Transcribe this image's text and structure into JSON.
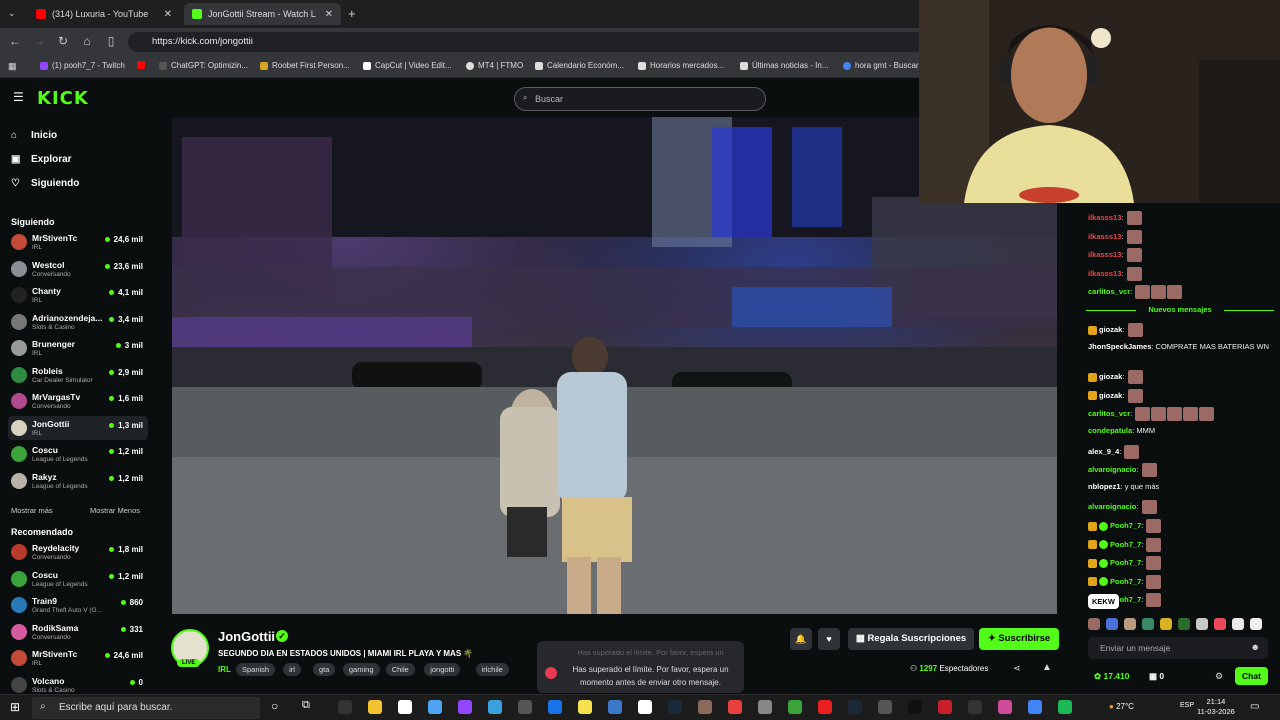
{
  "browser": {
    "tabs": [
      {
        "title": "(314) Luxuria - YouTube",
        "color": "#ff0000"
      },
      {
        "title": "JonGottii Stream - Watch L",
        "color": "#53fc18"
      }
    ],
    "url": "https://kick.com/jongottii",
    "bookmarks": [
      {
        "label": "(1) pooh7_7 - Twitch",
        "color": "#9146ff"
      },
      {
        "label": "",
        "color": "#ff0000"
      },
      {
        "label": "ChatGPT: Optimizin...",
        "color": "#444"
      },
      {
        "label": "Roobet First Person...",
        "color": "#d6a520"
      },
      {
        "label": "CapCut | Video Edit...",
        "color": "#ffffff"
      },
      {
        "label": "MT4 | FTMO",
        "color": "#dddddd"
      },
      {
        "label": "Calendario Económ...",
        "color": "#dddddd"
      },
      {
        "label": "Horarios mercados...",
        "color": "#dddddd"
      },
      {
        "label": "Últimas noticias - In...",
        "color": "#dddddd"
      },
      {
        "label": "hora gmt - Buscar",
        "color": "#4285f4"
      }
    ]
  },
  "kick": {
    "search_placeholder": "Buscar",
    "nav": [
      "Inicio",
      "Explorar",
      "Siguiendo"
    ],
    "following_header": "Siguiendo",
    "following": [
      {
        "name": "MrStivenTc",
        "category": "IRL",
        "viewers": "24,6 mil",
        "color": "#c24b3a"
      },
      {
        "name": "Westcol",
        "category": "Conversando",
        "viewers": "23,6 mil",
        "color": "#8a8f96"
      },
      {
        "name": "Chanty",
        "category": "IRL",
        "viewers": "4,1 mil",
        "color": "#222"
      },
      {
        "name": "Adrianozendeja...",
        "category": "Slots & Casino",
        "viewers": "3,4 mil",
        "color": "#777"
      },
      {
        "name": "Brunenger",
        "category": "IRL",
        "viewers": "3 mil",
        "color": "#9a9a9a"
      },
      {
        "name": "Robleis",
        "category": "Car Dealer Simulator",
        "viewers": "2,9 mil",
        "color": "#2d8a3e"
      },
      {
        "name": "MrVargasTv",
        "category": "Conversando",
        "viewers": "1,6 mil",
        "color": "#b04a8e"
      },
      {
        "name": "JonGottii",
        "category": "IRL",
        "viewers": "1,3 mil",
        "color": "#d9d2c0"
      },
      {
        "name": "Coscu",
        "category": "League of Legends",
        "viewers": "1,2 mil",
        "color": "#3aa33a"
      },
      {
        "name": "Rakyz",
        "category": "League of Legends",
        "viewers": "1,2 mil",
        "color": "#b8b2a8"
      }
    ],
    "show_more": "Mostrar más",
    "show_less": "Mostrar Menos",
    "recommended_header": "Recomendado",
    "recommended": [
      {
        "name": "Reydelacity",
        "category": "Conversando",
        "viewers": "1,8 mil",
        "color": "#b73a2a"
      },
      {
        "name": "Coscu",
        "category": "League of Legends",
        "viewers": "1,2 mil",
        "color": "#3aa33a"
      },
      {
        "name": "Train9",
        "category": "Grand Theft Auto V (G...",
        "viewers": "860",
        "color": "#2a7ab8"
      },
      {
        "name": "RodikSama",
        "category": "Conversando",
        "viewers": "331",
        "color": "#d65aa0"
      },
      {
        "name": "MrStivenTc",
        "category": "IRL",
        "viewers": "24,6 mil",
        "color": "#c24b3a"
      },
      {
        "name": "Volcano",
        "category": "Slots & Casino",
        "viewers": "0",
        "color": "#444"
      }
    ]
  },
  "stream": {
    "streamer": "JonGottii",
    "live": "LIVE",
    "title": "SEGUNDO DIA EN ESTADOS UNIDOS | MIAMI IRL PLAYA Y MAS 🌴",
    "category": "IRL",
    "tags": [
      "Spanish",
      "irl",
      "gta",
      "gaming",
      "Chile",
      "jongotti",
      "irlchile"
    ],
    "gift_label": "Regala Suscripciones",
    "subscribe_label": "Suscribirse",
    "viewers_count": "1297",
    "viewers_label": "Espectadores",
    "toast_faded": "Has superado el límite. Por favor, espera un",
    "toast_text": "Has superado el límite. Por favor, espera un momento antes de enviar otro mensaje."
  },
  "chat": {
    "messages_before": [
      {
        "user": "ilkasss13",
        "text": "",
        "color": "#e84848",
        "emotes": 1
      },
      {
        "user": "ilkasss13",
        "text": "",
        "color": "#e84848",
        "emotes": 1
      },
      {
        "user": "ilkasss13",
        "text": "",
        "color": "#e84848",
        "emotes": 1
      },
      {
        "user": "ilkasss13",
        "text": "",
        "color": "#e84848",
        "emotes": 1
      },
      {
        "user": "carlitos_vcr",
        "text": "",
        "color": "#53fc18",
        "emotes": 3
      }
    ],
    "new_messages": "Nuevos mensajes",
    "messages_after": [
      {
        "user": "giozak",
        "text": "",
        "color": "#fff",
        "emotes": 1,
        "badge": true
      },
      {
        "user": "JhonSpeckJames",
        "text": "COMPRATE MAS BATERIAS WN",
        "color": "#fff",
        "emotes": 0
      },
      {
        "user": "giozak",
        "text": "",
        "color": "#fff",
        "emotes": 1,
        "badge": true
      },
      {
        "user": "giozak",
        "text": "",
        "color": "#fff",
        "emotes": 1,
        "badge": true
      },
      {
        "user": "carlitos_vcr",
        "text": "",
        "color": "#53fc18",
        "emotes": 5
      },
      {
        "user": "condepatula",
        "text": "MMM",
        "color": "#53fc18",
        "emotes": 0
      },
      {
        "user": "alex_9_4",
        "text": "",
        "color": "#fff",
        "emotes": 1
      },
      {
        "user": "alvaroignacio",
        "text": "",
        "color": "#53fc18",
        "emotes": 1
      },
      {
        "user": "nblopez1",
        "text": "y que más",
        "color": "#fff",
        "emotes": 0
      },
      {
        "user": "alvaroignacio",
        "text": "",
        "color": "#53fc18",
        "emotes": 1
      },
      {
        "user": "Pooh7_7",
        "text": "",
        "color": "#53fc18",
        "emotes": 1,
        "badge": true
      },
      {
        "user": "Pooh7_7",
        "text": "",
        "color": "#53fc18",
        "emotes": 1,
        "badge": true
      },
      {
        "user": "Pooh7_7",
        "text": "",
        "color": "#53fc18",
        "emotes": 1,
        "badge": true
      },
      {
        "user": "Pooh7_7",
        "text": "",
        "color": "#53fc18",
        "emotes": 1,
        "badge": true
      },
      {
        "user": "Pooh7_7",
        "text": "",
        "color": "#53fc18",
        "emotes": 1,
        "badge": true
      }
    ],
    "tooltip": "KEKW",
    "input_placeholder": "Enviar un mensaje",
    "points": "17.410",
    "subs": "0",
    "send_label": "Chat"
  },
  "taskbar": {
    "search_placeholder": "Escribe aquí para buscar.",
    "temperature": "27°C",
    "language": "ESP",
    "time": "21:14",
    "date": "11-03-2026"
  }
}
